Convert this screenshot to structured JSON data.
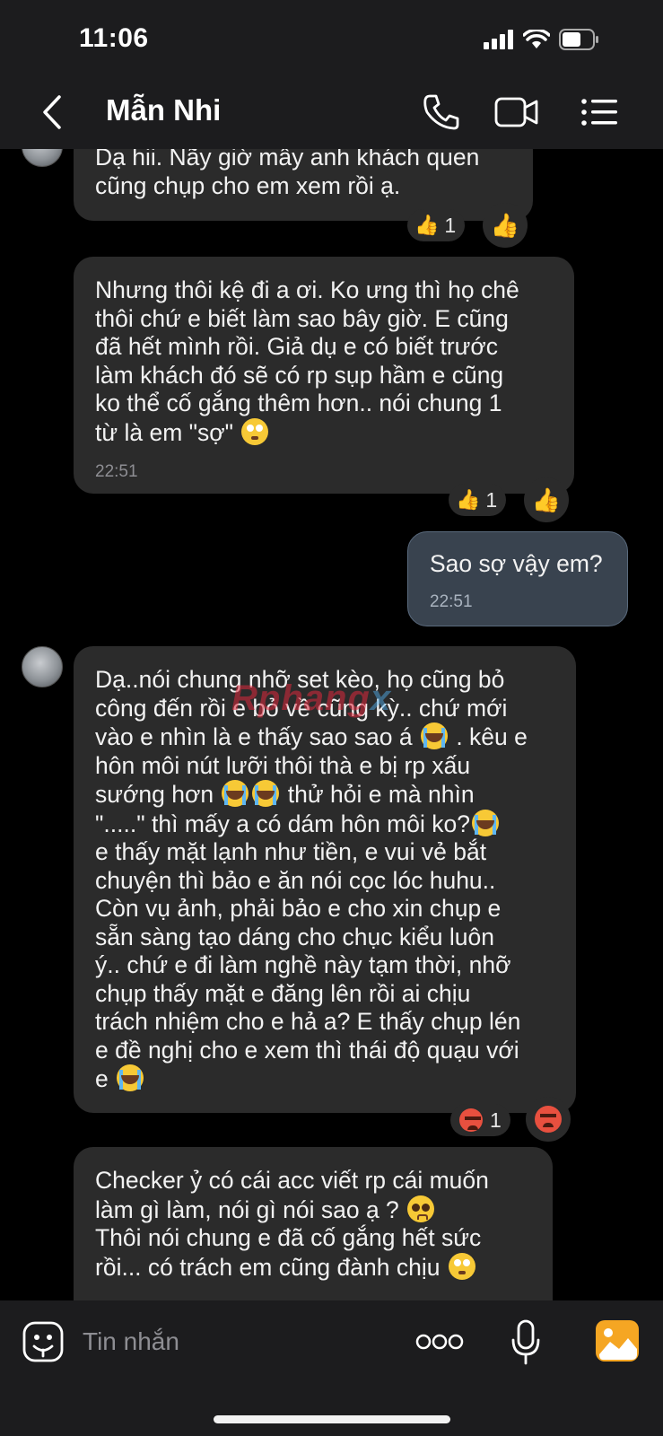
{
  "status_bar": {
    "time": "11:06"
  },
  "header": {
    "title": "Mẫn Nhi"
  },
  "messages": [
    {
      "text": "Dạ hii. Nãy giờ mây anh khách quen\ncũng chụp cho em xem rồi ạ.",
      "reaction_count": "1"
    },
    {
      "text": "Nhưng thôi kệ đi a ơi. Ko ưng thì họ chê\nthôi chứ e biết làm sao bây giờ. E cũng\nđã hết mình rồi. Giả dụ e có biết trước\nlàm khách đó sẽ có rp sụp hầm e cũng\nko thể cố gắng thêm hơn.. nói chung 1\ntừ là em \"sợ\"",
      "time": "22:51",
      "reaction_count": "1"
    },
    {
      "text": "Sao sợ vậy em?",
      "time": "22:51"
    },
    {
      "text": "Dạ..nói chung nhỡ set kèo, họ cũng bỏ\ncông đến rồi e bỏ về cũng kỳ.. chứ mới\nvào e nhìn là e thấy sao sao á",
      "text_b": " . kêu e\nhôn môi nút lưỡi thôi thà e bị rp xấu\nsướng hơn",
      "text_c": " thử hỏi e mà nhìn\n\".....\" thì mấy a có dám hôn môi ko?",
      "text_d": "\ne thấy mặt lạnh như tiền, e vui vẻ bắt\nchuyện thì bảo e ăn nói cọc lóc huhu..\nCòn vụ ảnh, phải bảo e cho xin chụp e\nsẵn sàng tạo dáng cho chục kiểu luôn\ný.. chứ e đi làm nghề này tạm thời, nhỡ\nchụp thấy mặt e đăng lên rồi ai chịu\ntrách nhiệm cho e hả a? E thấy chụp lén\ne đề nghị cho e xem thì thái độ quạu với\ne",
      "reaction_count": "1"
    },
    {
      "text": "Checker ỷ có cái acc viết rp cái muốn\nlàm gì làm, nói gì nói sao ạ ?",
      "text_b": "\nThôi nói chung e đã cố gắng hết sức\nrồi... có trách em cũng đành chịu"
    }
  ],
  "watermark": {
    "part_a": "Rphang",
    "part_b": "x"
  },
  "composer": {
    "placeholder": "Tin nhắn"
  },
  "colors": {
    "header_bg": "#1c1c1e",
    "bubble_bg": "#2b2b2b",
    "my_bubble_bg": "#39434f",
    "accent_image": "#f5a623"
  }
}
